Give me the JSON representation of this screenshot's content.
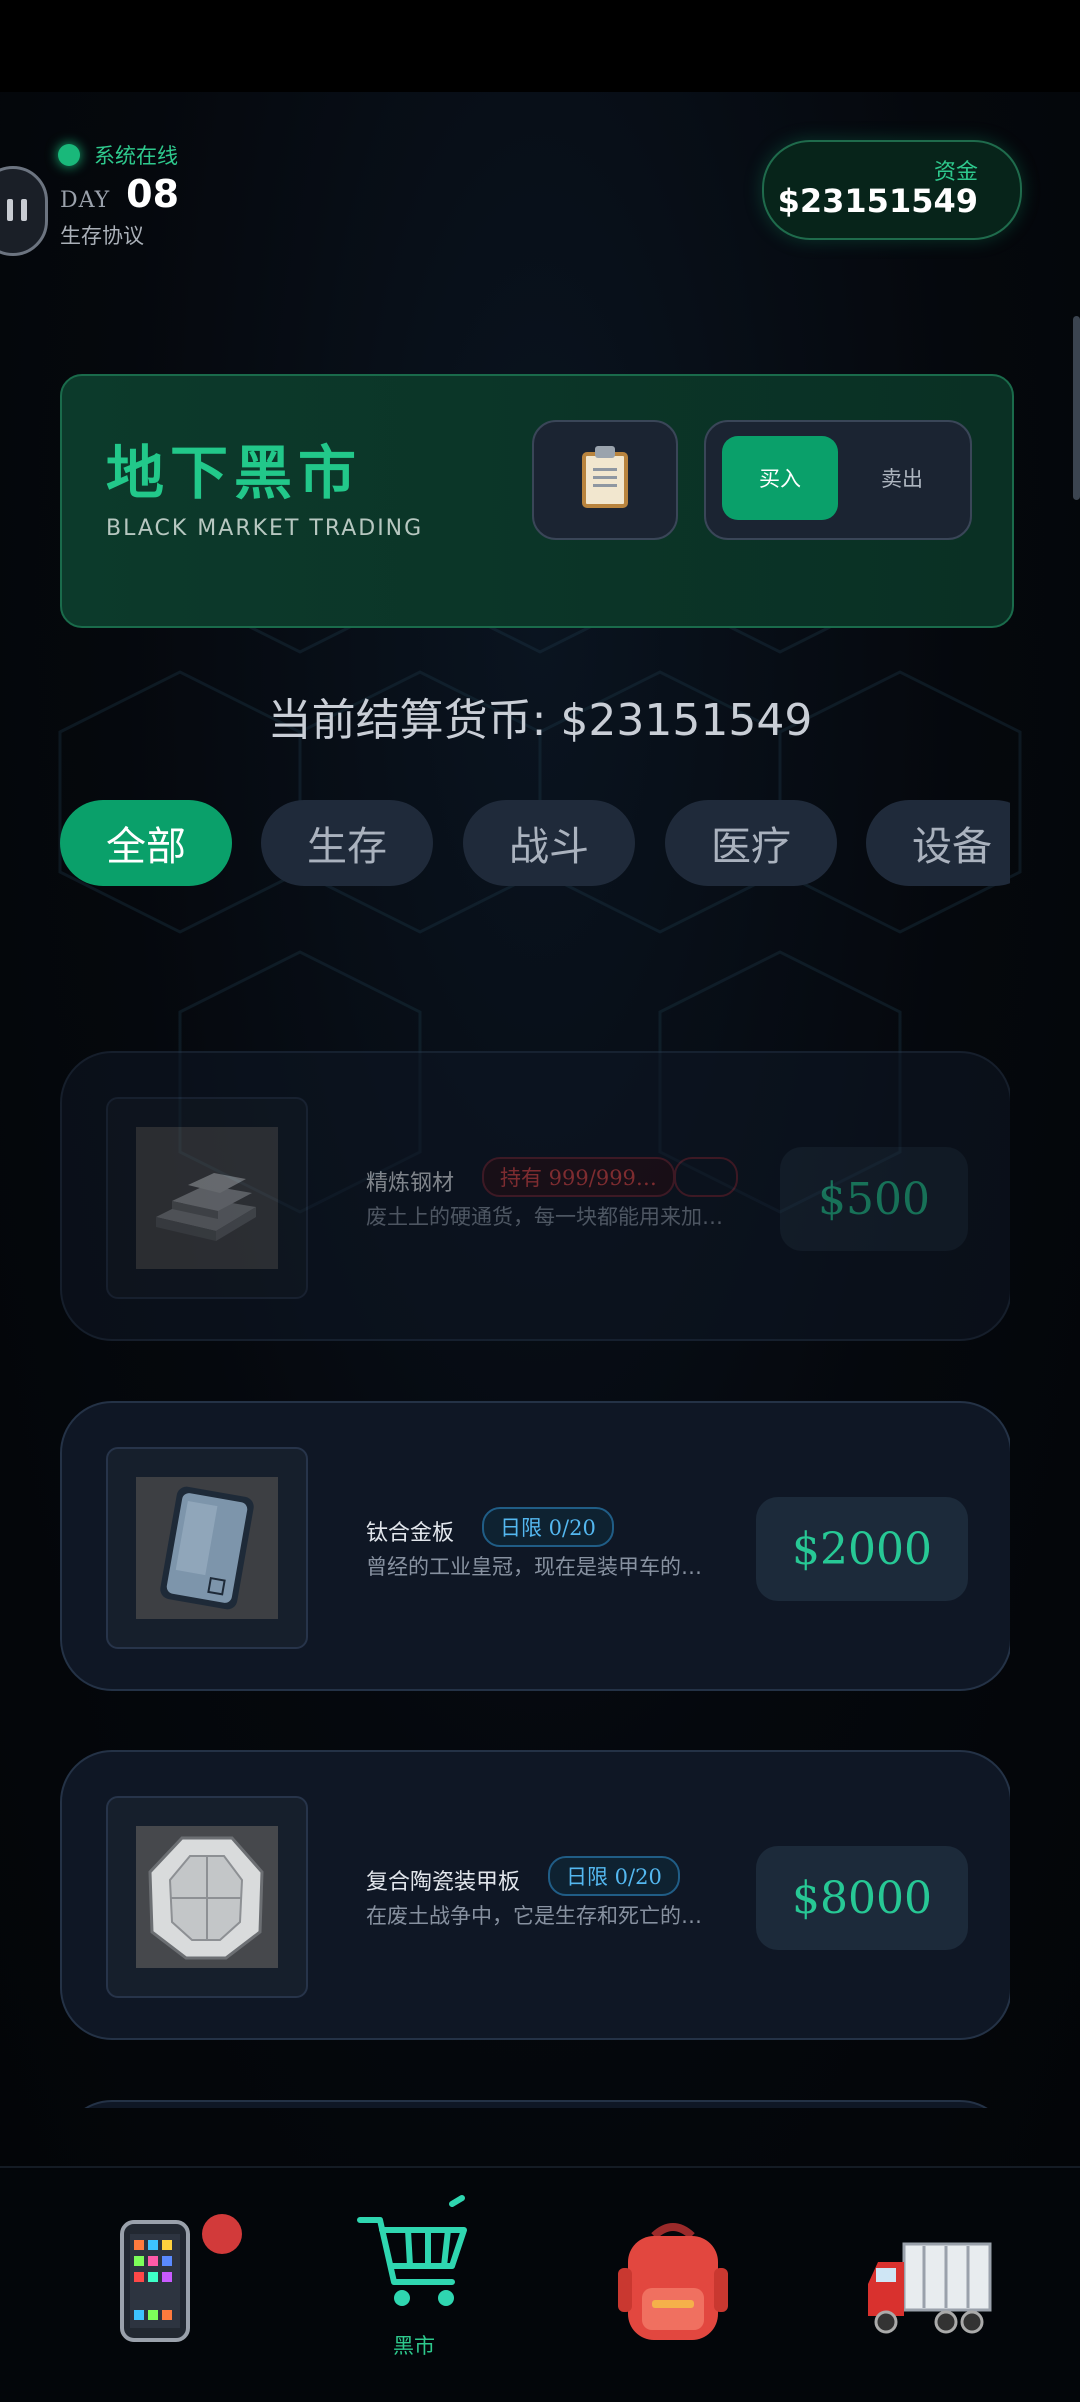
{
  "header": {
    "status_text": "系统在线",
    "day_label": "DAY",
    "day_number": "08",
    "protocol": "生存协议",
    "funds_label": "资金",
    "funds_value": "$23151549"
  },
  "market": {
    "title": "地下黑市",
    "subtitle": "BLACK MARKET TRADING",
    "clipboard_icon": "clipboard-icon",
    "buy_label": "买入",
    "sell_label": "卖出",
    "mode": "buy"
  },
  "currency_line": "当前结算货币: $23151549",
  "categories": [
    {
      "label": "全部",
      "active": true
    },
    {
      "label": "生存",
      "active": false
    },
    {
      "label": "战斗",
      "active": false
    },
    {
      "label": "医疗",
      "active": false
    },
    {
      "label": "设备",
      "active": false
    }
  ],
  "items": [
    {
      "name": "精炼钢材",
      "badge": "持有 999/999…",
      "badge_type": "red",
      "desc": "废土上的硬通货，每一块都能用来加…",
      "price": "$500",
      "icon": "steel-ingots-icon"
    },
    {
      "name": "钛合金板",
      "badge": "日限 0/20",
      "badge_type": "blue",
      "desc": "曾经的工业皇冠，现在是装甲车的…",
      "price": "$2000",
      "icon": "titanium-plate-icon"
    },
    {
      "name": "复合陶瓷装甲板",
      "badge": "日限 0/20",
      "badge_type": "blue",
      "desc": "在废土战争中，它是生存和死亡的…",
      "price": "$8000",
      "icon": "ceramic-armor-plate-icon"
    }
  ],
  "nav": [
    {
      "label": "",
      "icon": "phone-icon"
    },
    {
      "label": "黑市",
      "icon": "shopping-cart-icon",
      "active": true
    },
    {
      "label": "",
      "icon": "backpack-icon"
    },
    {
      "label": "",
      "icon": "truck-icon"
    }
  ],
  "colors": {
    "accent": "#0aa06a",
    "danger": "#e04545",
    "info": "#54b8f0"
  }
}
